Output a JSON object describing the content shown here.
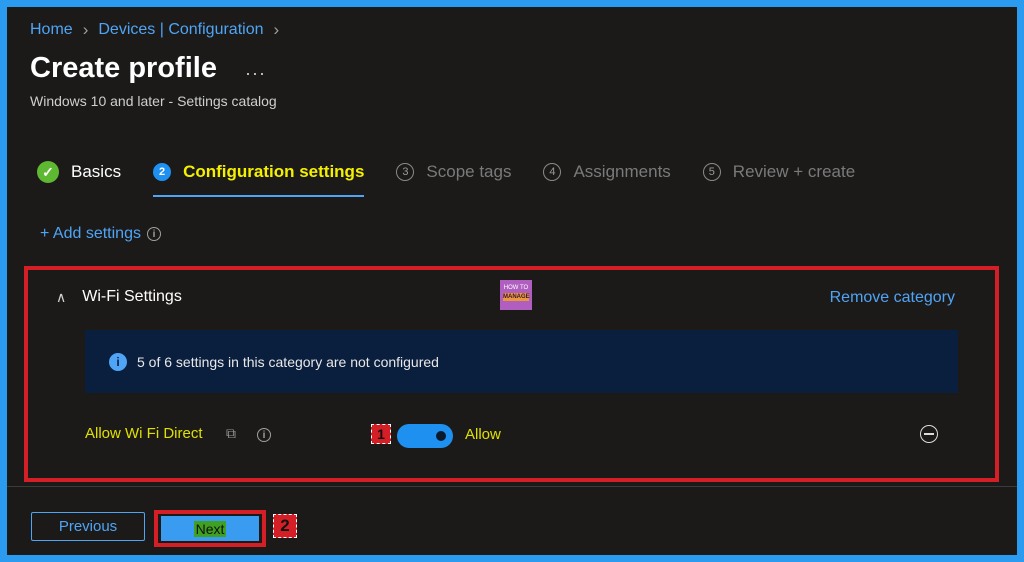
{
  "breadcrumb": {
    "home": "Home",
    "section": "Devices | Configuration"
  },
  "header": {
    "title": "Create profile",
    "more": "···",
    "subtitle": "Windows 10 and later - Settings catalog"
  },
  "steps": [
    {
      "label": "Basics",
      "state": "done"
    },
    {
      "num": "2",
      "label": "Configuration settings",
      "state": "active"
    },
    {
      "num": "3",
      "label": "Scope tags",
      "state": "pending"
    },
    {
      "num": "4",
      "label": "Assignments",
      "state": "pending"
    },
    {
      "num": "5",
      "label": "Review + create",
      "state": "pending"
    }
  ],
  "add_settings": {
    "label": "+ Add settings"
  },
  "category": {
    "title": "Wi-Fi Settings",
    "remove_label": "Remove category",
    "logo_text": [
      "HOW TO",
      "MANAGE"
    ],
    "notice": "5 of 6 settings in this category are not configured",
    "setting": {
      "name": "Allow Wi Fi Direct",
      "toggle_on": true,
      "value_label": "Allow",
      "callout": "1"
    }
  },
  "footer": {
    "previous_label": "Previous",
    "next_label": "Next",
    "callout": "2"
  },
  "colors": {
    "accent": "#4fa4f5",
    "highlight_border": "#d41f27",
    "highlight_text": "#e0e000",
    "background": "#1b1a19"
  }
}
